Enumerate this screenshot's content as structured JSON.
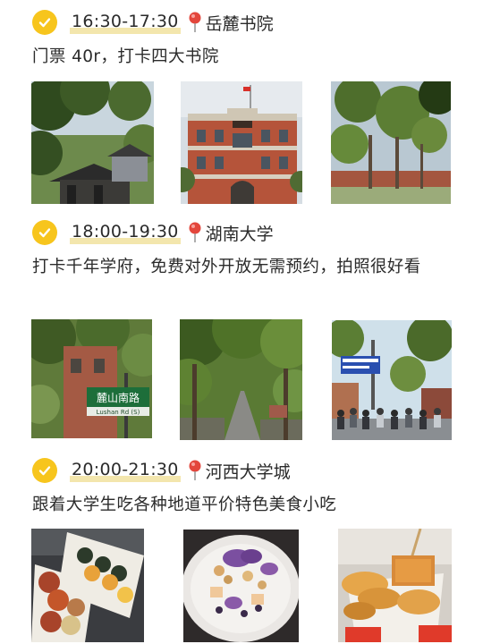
{
  "sections": [
    {
      "time": "16:30-17:30",
      "place": "岳麓书院",
      "desc": "门票 40r，打卡四大书院",
      "photos": [
        {
          "name": "photo-yuelu-pavilion"
        },
        {
          "name": "photo-yuelu-redbrick-building"
        },
        {
          "name": "photo-yuelu-trees"
        }
      ]
    },
    {
      "time": "18:00-19:30",
      "place": "湖南大学",
      "desc": "打卡千年学府，免费对外开放无需预约，拍照很好看",
      "photos": [
        {
          "name": "photo-lushan-road-sign"
        },
        {
          "name": "photo-tree-lined-avenue"
        },
        {
          "name": "photo-street-crowd"
        }
      ]
    },
    {
      "time": "20:00-21:30",
      "place": "河西大学城",
      "desc": "跟着大学生吃各种地道平价特色美食小吃",
      "photos": [
        {
          "name": "photo-sushi-boxes"
        },
        {
          "name": "photo-dessert-bowl"
        },
        {
          "name": "photo-fried-snacks"
        }
      ]
    }
  ],
  "sign_text": {
    "road_cn": "麓山南路",
    "road_en": "Lushan Rd (S)"
  },
  "colors": {
    "check": "#f7c51d",
    "pin": "#e3463c",
    "highlight": "#f3e6ad"
  }
}
